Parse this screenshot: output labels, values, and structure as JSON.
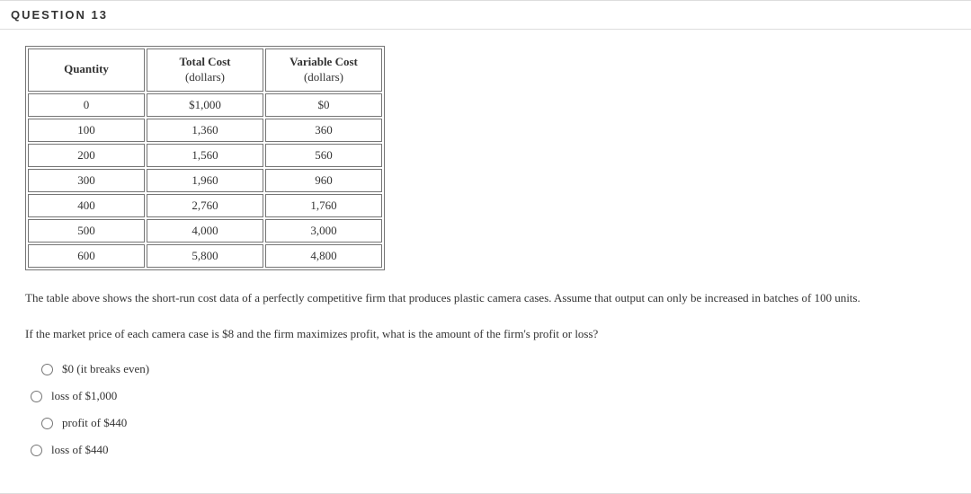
{
  "question_header": "QUESTION 13",
  "table": {
    "headers": [
      {
        "label": "Quantity",
        "sub": ""
      },
      {
        "label": "Total Cost",
        "sub": "(dollars)"
      },
      {
        "label": "Variable Cost",
        "sub": "(dollars)"
      }
    ],
    "rows": [
      {
        "q": "0",
        "tc": "$1,000",
        "vc": "$0"
      },
      {
        "q": "100",
        "tc": "1,360",
        "vc": "360"
      },
      {
        "q": "200",
        "tc": "1,560",
        "vc": "560"
      },
      {
        "q": "300",
        "tc": "1,960",
        "vc": "960"
      },
      {
        "q": "400",
        "tc": "2,760",
        "vc": "1,760"
      },
      {
        "q": "500",
        "tc": "4,000",
        "vc": "3,000"
      },
      {
        "q": "600",
        "tc": "5,800",
        "vc": "4,800"
      }
    ]
  },
  "paragraph1": "The table above shows the short-run cost data of a perfectly competitive firm that produces plastic camera cases. Assume that output can only be increased in batches of 100 units.",
  "paragraph2": "If the market price of each camera case is $8 and the firm maximizes profit, what is the amount of the firm's profit or loss?",
  "options": [
    "$0 (it breaks even)",
    "loss of $1,000",
    "profit of $440",
    "loss of $440"
  ]
}
